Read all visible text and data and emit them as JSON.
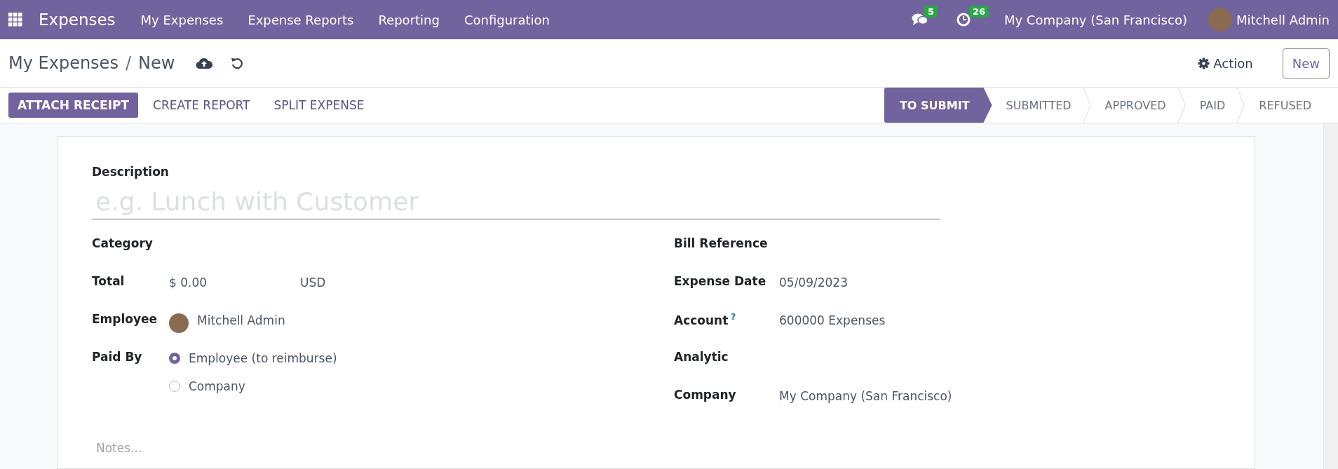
{
  "navbar": {
    "app_name": "Expenses",
    "menu": [
      "My Expenses",
      "Expense Reports",
      "Reporting",
      "Configuration"
    ],
    "messages_count": "5",
    "activities_count": "26",
    "company": "My Company (San Francisco)",
    "user": "Mitchell Admin"
  },
  "breadcrumb": {
    "parent": "My Expenses",
    "separator": "/",
    "current": "New"
  },
  "action_button": "Action",
  "new_button": "New",
  "buttons": [
    {
      "label": "ATTACH RECEIPT",
      "kind": "primary"
    },
    {
      "label": "CREATE REPORT",
      "kind": "link"
    },
    {
      "label": "SPLIT EXPENSE",
      "kind": "link"
    }
  ],
  "stages": [
    {
      "label": "TO SUBMIT",
      "selected": true
    },
    {
      "label": "SUBMITTED",
      "selected": false
    },
    {
      "label": "APPROVED",
      "selected": false
    },
    {
      "label": "PAID",
      "selected": false
    },
    {
      "label": "REFUSED",
      "selected": false
    }
  ],
  "form": {
    "description_label": "Description",
    "description_placeholder": "e.g. Lunch with Customer",
    "left_fields": [
      {
        "label": "Category",
        "kind": "text"
      },
      {
        "label": "Total",
        "kind": "amount",
        "value": "$ 0.00",
        "currency": "USD"
      },
      {
        "label": "Employee",
        "kind": "avatar",
        "value": "Mitchell Admin"
      },
      {
        "label": "Paid By",
        "kind": "radio",
        "options": [
          {
            "label": "Employee (to reimburse)",
            "selected": true
          },
          {
            "label": "Company",
            "selected": false
          }
        ]
      }
    ],
    "right_fields": [
      {
        "label": "Bill Reference",
        "kind": "text"
      },
      {
        "label": "Expense Date",
        "kind": "text",
        "value": "05/09/2023"
      },
      {
        "label": "Account",
        "kind": "text",
        "help": "?",
        "value": "600000 Expenses"
      },
      {
        "label": "Analytic",
        "kind": "text"
      },
      {
        "label": "Company",
        "kind": "text",
        "value": "My Company (San Francisco)"
      }
    ],
    "notes_placeholder": "Notes..."
  }
}
